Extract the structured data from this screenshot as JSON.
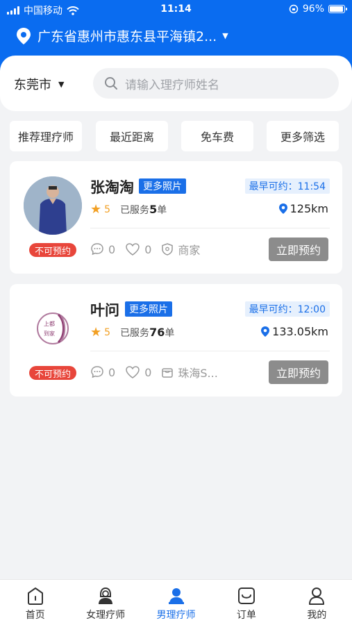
{
  "status_bar": {
    "carrier": "中国移动",
    "time": "11:14",
    "battery": "96%",
    "battery_level": 0.96
  },
  "header": {
    "location": "广东省惠州市惠东县平海镇2..."
  },
  "search": {
    "city": "东莞市",
    "placeholder": "请输入理疗师姓名"
  },
  "filters": [
    "推荐理疗师",
    "最近距离",
    "免车费",
    "更多筛选"
  ],
  "therapists": [
    {
      "name": "张淘淘",
      "photos_tag": "更多照片",
      "earliest": "最早可约：11:54",
      "rating": "5",
      "served_prefix": "已服务",
      "served_count": "5",
      "served_suffix": "单",
      "distance": "125km",
      "comments": "0",
      "likes": "0",
      "shop": "商家",
      "status": "不可预约",
      "book_label": "立即预约"
    },
    {
      "name": "叶问",
      "photos_tag": "更多照片",
      "earliest": "最早可约：12:00",
      "rating": "5",
      "served_prefix": "已服务",
      "served_count": "76",
      "served_suffix": "单",
      "distance": "133.05km",
      "comments": "0",
      "likes": "0",
      "shop": "珠海S...",
      "status": "不可预约",
      "book_label": "立即预约",
      "logo_text": "上都到家"
    }
  ],
  "nav": [
    {
      "label": "首页",
      "icon": "home-icon"
    },
    {
      "label": "女理疗师",
      "icon": "female-therapist-icon"
    },
    {
      "label": "男理疗师",
      "icon": "male-therapist-icon",
      "active": true
    },
    {
      "label": "订单",
      "icon": "order-icon"
    },
    {
      "label": "我的",
      "icon": "profile-icon"
    }
  ],
  "colors": {
    "primary": "#0a6cf0",
    "accent_blue": "#1a6fe8",
    "danger": "#e8463b",
    "star": "#f2a024"
  }
}
